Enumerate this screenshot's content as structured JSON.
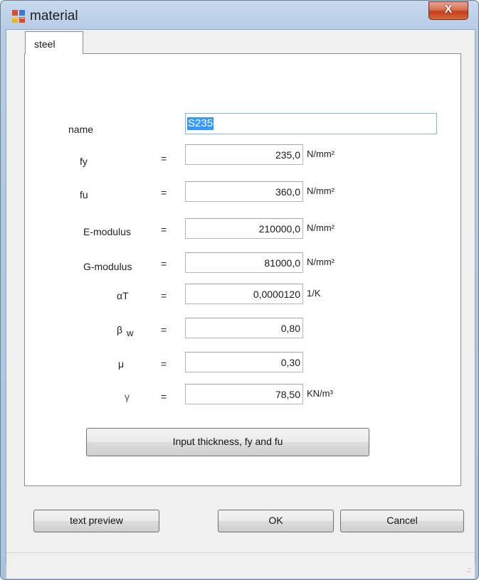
{
  "window": {
    "title": "material",
    "close_glyph": "X"
  },
  "tabs": [
    {
      "label": "steel",
      "selected": true
    }
  ],
  "form": {
    "name": {
      "label": "name",
      "value": "S235"
    },
    "rows": [
      {
        "label": "fy",
        "value": "235,0",
        "unit": "N/mm²"
      },
      {
        "label": "fu",
        "value": "360,0",
        "unit": "N/mm²"
      },
      {
        "label": "E-modulus",
        "value": "210000,0",
        "unit": "N/mm²"
      },
      {
        "label": "G-modulus",
        "value": "81000,0",
        "unit": "N/mm²"
      },
      {
        "label": "αT",
        "value": "0,0000120",
        "unit": "1/K"
      },
      {
        "label": "β",
        "sub": "w",
        "value": "0,80",
        "unit": ""
      },
      {
        "label": "μ",
        "value": "0,30",
        "unit": ""
      },
      {
        "label": "γ",
        "value": "78,50",
        "unit": "KN/m³"
      }
    ],
    "equals": "="
  },
  "buttons": {
    "input_thickness": "Input thickness, fy and fu",
    "text_preview": "text preview",
    "ok": "OK",
    "cancel": "Cancel"
  },
  "statusbar": {
    "grip": ".::"
  },
  "icons": {
    "app": "form-icon",
    "close": "close-icon"
  },
  "colors": {
    "title_bar": "#b7cde6",
    "close_button": "#c8472a",
    "selection": "#3399ff"
  }
}
